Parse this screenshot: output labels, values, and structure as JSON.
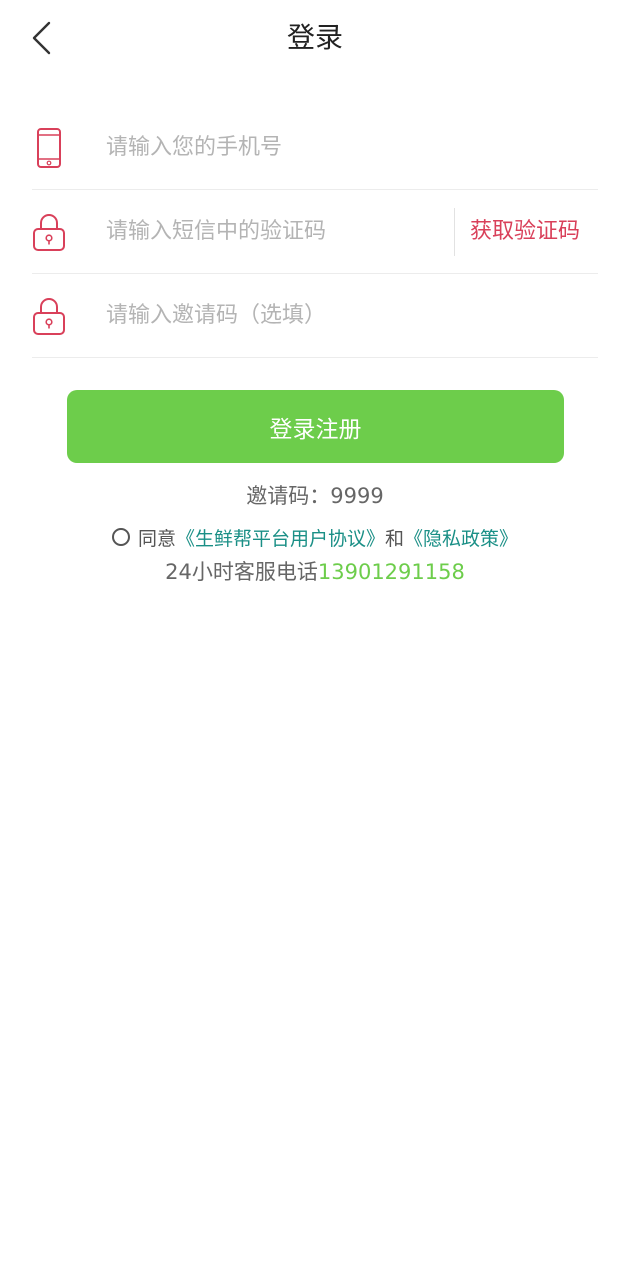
{
  "nav": {
    "title": "登录",
    "back_icon": "chevron-left-icon"
  },
  "form": {
    "phone": {
      "value": "",
      "placeholder": "请输入您的手机号",
      "icon": "phone-icon"
    },
    "sms_code": {
      "value": "",
      "placeholder": "请输入短信中的验证码",
      "icon": "lock-icon"
    },
    "get_code_label": "获取验证码",
    "invite": {
      "value": "",
      "placeholder": "请输入邀请码（选填）",
      "icon": "lock-icon"
    }
  },
  "submit_label": "登录注册",
  "invite_code_text": "邀请码：9999",
  "agreement": {
    "checked": false,
    "prefix": "同意",
    "user_agreement": "《生鲜帮平台用户协议》",
    "and": "和",
    "privacy_policy": "《隐私政策》"
  },
  "service": {
    "label": "24小时客服电话",
    "phone": "13901291158"
  },
  "colors": {
    "accent_green": "#6dcd4b",
    "icon_red": "#d9405a",
    "link_teal": "#1a8f86"
  }
}
